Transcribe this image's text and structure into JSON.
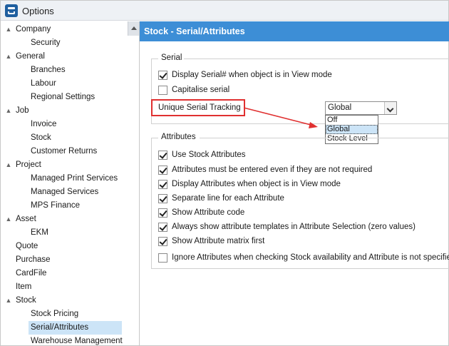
{
  "window": {
    "title": "Options"
  },
  "sidebar": {
    "items": [
      {
        "label": "Company",
        "expander": "▲",
        "level": 0
      },
      {
        "label": "Security",
        "level": 1
      },
      {
        "label": "General",
        "expander": "▲",
        "level": 0
      },
      {
        "label": "Branches",
        "level": 1
      },
      {
        "label": "Labour",
        "level": 1
      },
      {
        "label": "Regional Settings",
        "level": 1
      },
      {
        "label": "Job",
        "expander": "▲",
        "level": 0
      },
      {
        "label": "Invoice",
        "level": 1
      },
      {
        "label": "Stock",
        "level": 1
      },
      {
        "label": "Customer Returns",
        "level": 1
      },
      {
        "label": "Project",
        "expander": "▲",
        "level": 0
      },
      {
        "label": "Managed Print Services",
        "level": 1
      },
      {
        "label": "Managed Services",
        "level": 1
      },
      {
        "label": "MPS Finance",
        "level": 1
      },
      {
        "label": "Asset",
        "expander": "▲",
        "level": 0
      },
      {
        "label": "EKM",
        "level": 1
      },
      {
        "label": "Quote",
        "level": 0
      },
      {
        "label": "Purchase",
        "level": 0
      },
      {
        "label": "CardFile",
        "level": 0
      },
      {
        "label": "Item",
        "level": 0
      },
      {
        "label": "Stock",
        "expander": "▲",
        "level": 0
      },
      {
        "label": "Stock Pricing",
        "level": 1
      },
      {
        "label": "Serial/Attributes",
        "level": 1,
        "selected": true
      },
      {
        "label": "Warehouse Management",
        "level": 1
      }
    ]
  },
  "main": {
    "header": "Stock - Serial/Attributes",
    "serial": {
      "title": "Serial",
      "display_serial": {
        "label": "Display Serial# when object is in View mode",
        "checked": true
      },
      "capitalise": {
        "label": "Capitalise serial",
        "checked": false
      },
      "tracking_label": "Unique Serial Tracking",
      "tracking_value": "Global",
      "tracking_options": [
        "Off",
        "Global",
        "Stock Level"
      ],
      "tracking_selected": "Global"
    },
    "attributes": {
      "title": "Attributes",
      "options": [
        {
          "label": "Use Stock Attributes",
          "checked": true
        },
        {
          "label": "Attributes must be entered even if they are not required",
          "checked": true
        },
        {
          "label": "Display Attributes when object is in View mode",
          "checked": true
        },
        {
          "label": "Separate line for each Attribute",
          "checked": true
        },
        {
          "label": "Show Attribute code",
          "checked": true
        },
        {
          "label": "Always show attribute templates in Attribute Selection (zero values)",
          "checked": true
        },
        {
          "label": "Show Attribute matrix first",
          "checked": true
        },
        {
          "label": "Ignore Attributes when checking Stock availability and Attribute is not specified",
          "checked": false
        }
      ]
    }
  },
  "colors": {
    "header": "#3d8ed6",
    "callout": "#e03030",
    "selection": "#cce4f7"
  }
}
